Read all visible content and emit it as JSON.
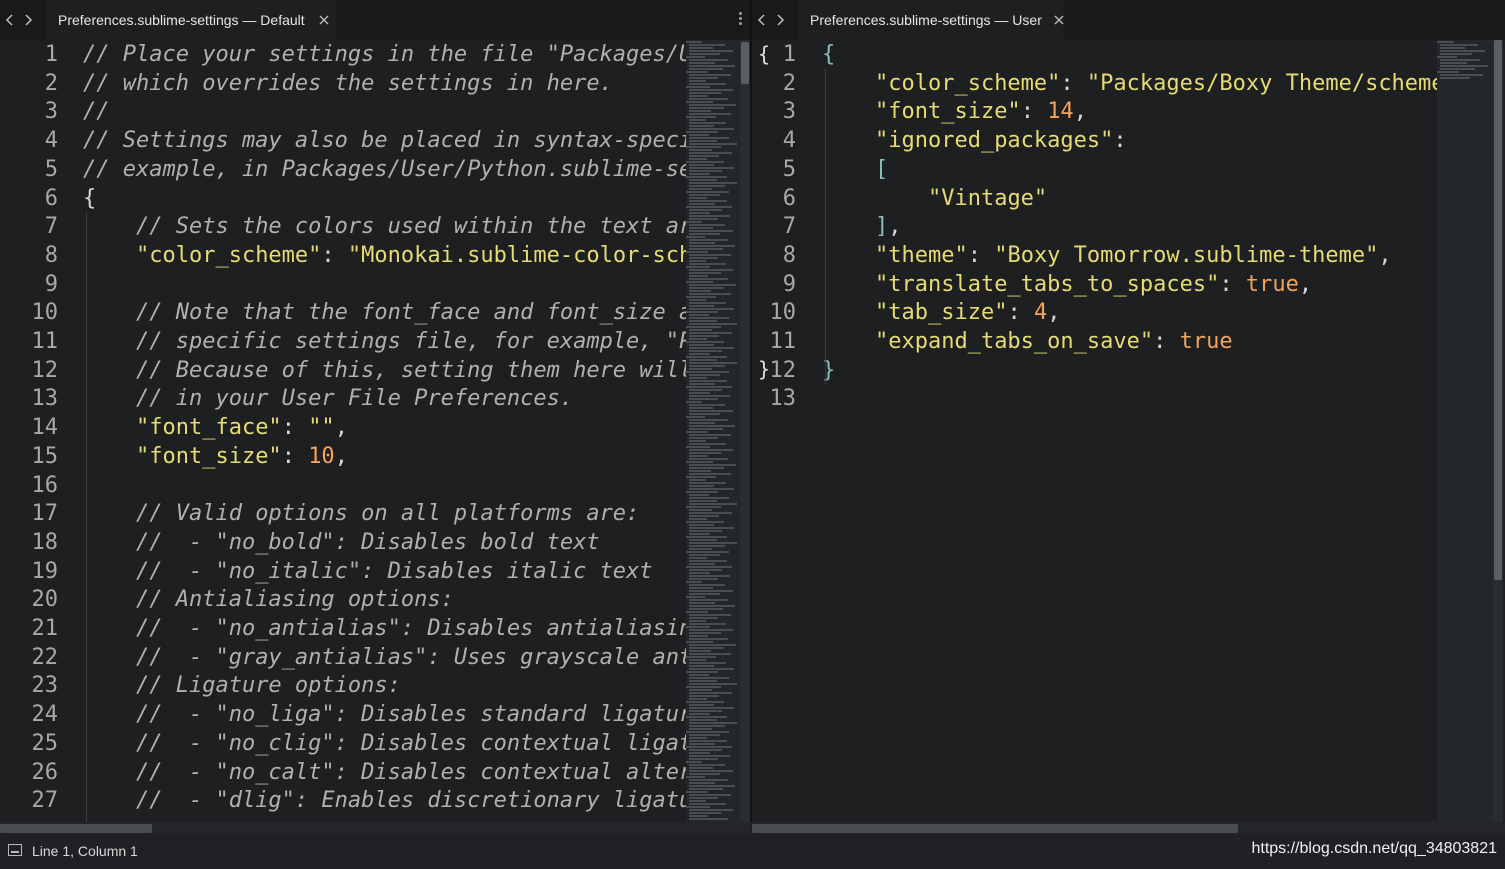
{
  "left_pane": {
    "tab_title": "Preferences.sublime-settings — Default",
    "lines": [
      {
        "n": "1",
        "tokens": [
          [
            "cm",
            "// Place your settings in the file \"Packages/User/Preferences.sublime-settings\","
          ]
        ]
      },
      {
        "n": "2",
        "tokens": [
          [
            "cm",
            "// which overrides the settings in here."
          ]
        ]
      },
      {
        "n": "3",
        "tokens": [
          [
            "cm",
            "//"
          ]
        ]
      },
      {
        "n": "4",
        "tokens": [
          [
            "cm",
            "// Settings may also be placed in syntax-specific setting files, for"
          ]
        ]
      },
      {
        "n": "5",
        "tokens": [
          [
            "cm",
            "// example, in Packages/User/Python.sublime-settings for python files."
          ]
        ]
      },
      {
        "n": "6",
        "tokens": [
          [
            "pu",
            "{"
          ]
        ]
      },
      {
        "n": "7",
        "tokens": [
          [
            "pu",
            "    "
          ],
          [
            "cm",
            "// Sets the colors used within the text area"
          ]
        ]
      },
      {
        "n": "8",
        "tokens": [
          [
            "pu",
            "    "
          ],
          [
            "st",
            "\"color_scheme\""
          ],
          [
            "pu",
            ": "
          ],
          [
            "st",
            "\"Monokai.sublime-color-scheme\""
          ],
          [
            "pu",
            ","
          ]
        ]
      },
      {
        "n": "9",
        "tokens": [
          [
            "pu",
            ""
          ]
        ]
      },
      {
        "n": "10",
        "tokens": [
          [
            "pu",
            "    "
          ],
          [
            "cm",
            "// Note that the font_face and font_size are overridden in the platform"
          ]
        ]
      },
      {
        "n": "11",
        "tokens": [
          [
            "pu",
            "    "
          ],
          [
            "cm",
            "// specific settings file, for example, \"Preferences (Linux).sublime-settings\"."
          ]
        ]
      },
      {
        "n": "12",
        "tokens": [
          [
            "pu",
            "    "
          ],
          [
            "cm",
            "// Because of this, setting them here will have no effect: you must set them"
          ]
        ]
      },
      {
        "n": "13",
        "tokens": [
          [
            "pu",
            "    "
          ],
          [
            "cm",
            "// in your User File Preferences."
          ]
        ]
      },
      {
        "n": "14",
        "tokens": [
          [
            "pu",
            "    "
          ],
          [
            "st",
            "\"font_face\""
          ],
          [
            "pu",
            ": "
          ],
          [
            "st",
            "\"\""
          ],
          [
            "pu",
            ","
          ]
        ]
      },
      {
        "n": "15",
        "tokens": [
          [
            "pu",
            "    "
          ],
          [
            "st",
            "\"font_size\""
          ],
          [
            "pu",
            ": "
          ],
          [
            "nu",
            "10"
          ],
          [
            "pu",
            ","
          ]
        ]
      },
      {
        "n": "16",
        "tokens": [
          [
            "pu",
            ""
          ]
        ]
      },
      {
        "n": "17",
        "tokens": [
          [
            "pu",
            "    "
          ],
          [
            "cm",
            "// Valid options on all platforms are:"
          ]
        ]
      },
      {
        "n": "18",
        "tokens": [
          [
            "pu",
            "    "
          ],
          [
            "cm",
            "//  - \"no_bold\": Disables bold text"
          ]
        ]
      },
      {
        "n": "19",
        "tokens": [
          [
            "pu",
            "    "
          ],
          [
            "cm",
            "//  - \"no_italic\": Disables italic text"
          ]
        ]
      },
      {
        "n": "20",
        "tokens": [
          [
            "pu",
            "    "
          ],
          [
            "cm",
            "// Antialiasing options:"
          ]
        ]
      },
      {
        "n": "21",
        "tokens": [
          [
            "pu",
            "    "
          ],
          [
            "cm",
            "//  - \"no_antialias\": Disables antialiasing"
          ]
        ]
      },
      {
        "n": "22",
        "tokens": [
          [
            "pu",
            "    "
          ],
          [
            "cm",
            "//  - \"gray_antialias\": Uses grayscale antialiasing instead of subpixel"
          ]
        ]
      },
      {
        "n": "23",
        "tokens": [
          [
            "pu",
            "    "
          ],
          [
            "cm",
            "// Ligature options:"
          ]
        ]
      },
      {
        "n": "24",
        "tokens": [
          [
            "pu",
            "    "
          ],
          [
            "cm",
            "//  - \"no_liga\": Disables standard ligatures (fi, ff, etc)"
          ]
        ]
      },
      {
        "n": "25",
        "tokens": [
          [
            "pu",
            "    "
          ],
          [
            "cm",
            "//  - \"no_clig\": Disables contextual ligatures"
          ]
        ]
      },
      {
        "n": "26",
        "tokens": [
          [
            "pu",
            "    "
          ],
          [
            "cm",
            "//  - \"no_calt\": Disables contextual alternatives"
          ]
        ]
      },
      {
        "n": "27",
        "tokens": [
          [
            "pu",
            "    "
          ],
          [
            "cm",
            "//  - \"dlig\": Enables discretionary ligatures"
          ]
        ]
      }
    ]
  },
  "right_pane": {
    "tab_title": "Preferences.sublime-settings — User",
    "fold_open": "{",
    "fold_close": "}",
    "lines": [
      {
        "n": "1",
        "tokens": [
          [
            "br",
            "{"
          ]
        ]
      },
      {
        "n": "2",
        "tokens": [
          [
            "pu",
            "    "
          ],
          [
            "st",
            "\"color_scheme\""
          ],
          [
            "pu",
            ": "
          ],
          [
            "st",
            "\"Packages/Boxy Theme/schemes/Boxy Tomorrow.tmTheme\""
          ],
          [
            "pu",
            ","
          ]
        ]
      },
      {
        "n": "3",
        "tokens": [
          [
            "pu",
            "    "
          ],
          [
            "st",
            "\"font_size\""
          ],
          [
            "pu",
            ": "
          ],
          [
            "nu",
            "14"
          ],
          [
            "pu",
            ","
          ]
        ]
      },
      {
        "n": "4",
        "tokens": [
          [
            "pu",
            "    "
          ],
          [
            "st",
            "\"ignored_packages\""
          ],
          [
            "pu",
            ":"
          ]
        ]
      },
      {
        "n": "5",
        "tokens": [
          [
            "pu",
            "    "
          ],
          [
            "br",
            "["
          ]
        ]
      },
      {
        "n": "6",
        "tokens": [
          [
            "pu",
            "        "
          ],
          [
            "st",
            "\"Vintage\""
          ]
        ]
      },
      {
        "n": "7",
        "tokens": [
          [
            "pu",
            "    "
          ],
          [
            "br",
            "]"
          ],
          [
            "pu",
            ","
          ]
        ]
      },
      {
        "n": "8",
        "tokens": [
          [
            "pu",
            "    "
          ],
          [
            "st",
            "\"theme\""
          ],
          [
            "pu",
            ": "
          ],
          [
            "st",
            "\"Boxy Tomorrow.sublime-theme\""
          ],
          [
            "pu",
            ","
          ]
        ]
      },
      {
        "n": "9",
        "tokens": [
          [
            "pu",
            "    "
          ],
          [
            "st",
            "\"translate_tabs_to_spaces\""
          ],
          [
            "pu",
            ": "
          ],
          [
            "kw",
            "true"
          ],
          [
            "pu",
            ","
          ]
        ]
      },
      {
        "n": "10",
        "tokens": [
          [
            "pu",
            "    "
          ],
          [
            "st",
            "\"tab_size\""
          ],
          [
            "pu",
            ": "
          ],
          [
            "nu",
            "4"
          ],
          [
            "pu",
            ","
          ]
        ]
      },
      {
        "n": "11",
        "tokens": [
          [
            "pu",
            "    "
          ],
          [
            "st",
            "\"expand_tabs_on_save\""
          ],
          [
            "pu",
            ": "
          ],
          [
            "kw",
            "true"
          ]
        ]
      },
      {
        "n": "12",
        "tokens": [
          [
            "br",
            "}"
          ]
        ]
      },
      {
        "n": "13",
        "tokens": [
          [
            "pu",
            ""
          ]
        ]
      }
    ]
  },
  "icons": {
    "nav_back": "chevron-left-icon",
    "nav_forward": "chevron-right-icon",
    "tab_close": "close-icon",
    "tab_menu": "more-vertical-icon",
    "status_panel": "panel-toggle-icon"
  },
  "statusbar": {
    "position": "Line 1, Column 1",
    "watermark": "https://blog.csdn.net/qq_34803821"
  },
  "colors": {
    "background": "#1d1f21",
    "comment": "#b0b0b0",
    "string": "#e6db74",
    "number": "#f4a35a",
    "bracket": "#8abeb7"
  }
}
